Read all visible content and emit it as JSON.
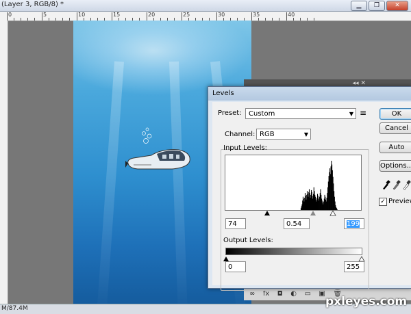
{
  "window": {
    "title": "(Layer 3, RGB/8) *",
    "minimize_glyph": "▁",
    "restore_glyph": "❐",
    "close_glyph": "✕"
  },
  "ruler": {
    "labels": [
      "0",
      "5",
      "10",
      "15",
      "20",
      "25",
      "30",
      "35",
      "40"
    ]
  },
  "status_bar": {
    "text": "M/87.4M"
  },
  "panel": {
    "collapse_glyph": "◂◂",
    "close_glyph": "✕",
    "layer_icons": [
      "∞",
      "fx",
      "◘",
      "◐",
      "▭",
      "▣",
      "🗑"
    ]
  },
  "levels": {
    "title": "Levels",
    "preset_label": "Preset:",
    "preset_value": "Custom",
    "preset_menu_icon": "≡",
    "channel_label": "Channel:",
    "channel_value": "RGB",
    "input_levels_label": "Input Levels:",
    "input_black": "74",
    "input_gamma": "0.54",
    "input_white": "199",
    "output_levels_label": "Output Levels:",
    "output_black": "0",
    "output_white": "255",
    "buttons": {
      "ok": "OK",
      "cancel": "Cancel",
      "auto": "Auto",
      "options": "Options..."
    },
    "preview_label": "Preview",
    "preview_checked": true,
    "check_glyph": "✓",
    "histogram": [
      0,
      0,
      0,
      0,
      0,
      0,
      0,
      0,
      0,
      0,
      0,
      0,
      0,
      0,
      0,
      0,
      0,
      0,
      0,
      0,
      0,
      0,
      0,
      0,
      0,
      0,
      0,
      0,
      0,
      0,
      0,
      0,
      0,
      0,
      0,
      0,
      0,
      0,
      0,
      0,
      0,
      0,
      0,
      0,
      0,
      0,
      0,
      0,
      0,
      0,
      0,
      0,
      0,
      0,
      0,
      0,
      0,
      0,
      0,
      0,
      0,
      0,
      0,
      0,
      0,
      0,
      0,
      0,
      0,
      0,
      0,
      0,
      0,
      0,
      0,
      0,
      0,
      0,
      0,
      0,
      0,
      0,
      0,
      0,
      0,
      0,
      0,
      0,
      0,
      0,
      0,
      0,
      0,
      0,
      0,
      0,
      0,
      0,
      0,
      0,
      0,
      0,
      0,
      0,
      0,
      0,
      0,
      0,
      0,
      0,
      0,
      0,
      0,
      0,
      0,
      0,
      0,
      0,
      0,
      0,
      0,
      0,
      0,
      0,
      0,
      0,
      0,
      0,
      0,
      0,
      0,
      0,
      0,
      0,
      0,
      0,
      0,
      0,
      0,
      0,
      0,
      0,
      0,
      0,
      0,
      0,
      2,
      4,
      6,
      10,
      14,
      12,
      9,
      13,
      18,
      15,
      11,
      16,
      20,
      17,
      14,
      19,
      22,
      18,
      13,
      16,
      21,
      19,
      15,
      12,
      17,
      24,
      20,
      16,
      14,
      11,
      9,
      13,
      17,
      15,
      12,
      10,
      14,
      18,
      22,
      16,
      12,
      10,
      8,
      6,
      9,
      12,
      16,
      14,
      11,
      9,
      13,
      18,
      24,
      30,
      36,
      40,
      44,
      38,
      46,
      52,
      48,
      42,
      35,
      28,
      20,
      14,
      9,
      5,
      3,
      2,
      1,
      0,
      0,
      0,
      0,
      0,
      0,
      0,
      0,
      0,
      0,
      0,
      0,
      0,
      0,
      0,
      0,
      0,
      0,
      0,
      0,
      0,
      0,
      0,
      0,
      0,
      0,
      0,
      0,
      0,
      0,
      0,
      0,
      0,
      0,
      0,
      0,
      0,
      0,
      0,
      0,
      0,
      0,
      0,
      0,
      0,
      0
    ]
  },
  "watermark": {
    "text": "pxleyes.com"
  }
}
